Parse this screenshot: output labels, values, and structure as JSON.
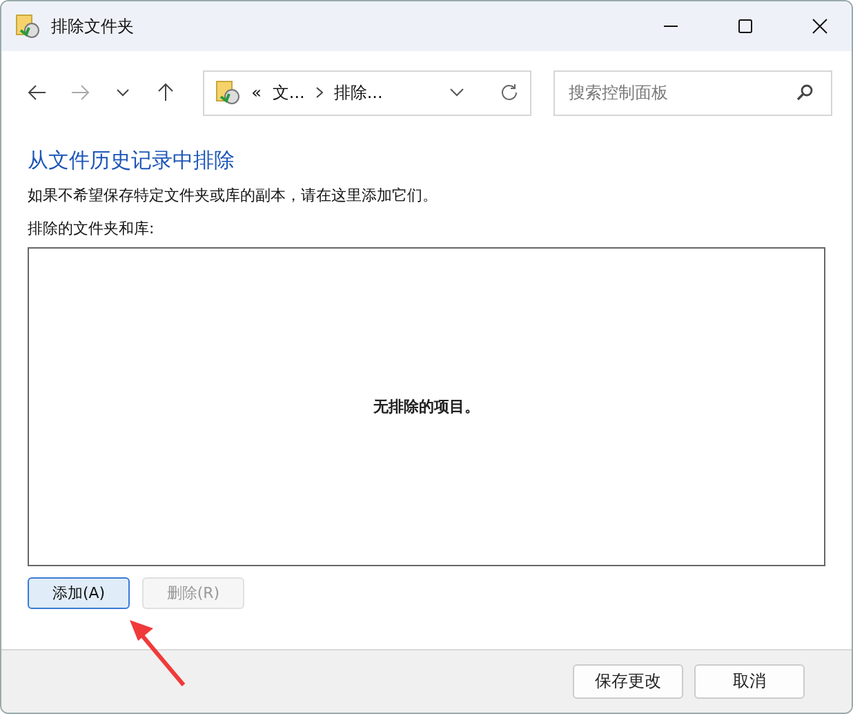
{
  "window": {
    "title": "排除文件夹"
  },
  "address_bar": {
    "overflow": "«",
    "crumbs": [
      "文...",
      "排除..."
    ]
  },
  "search": {
    "placeholder": "搜索控制面板"
  },
  "heading": "从文件历史记录中排除",
  "description": "如果不希望保存特定文件夹或库的副本，请在这里添加它们。",
  "list_label": "排除的文件夹和库:",
  "list": {
    "empty_text": "无排除的项目。"
  },
  "list_buttons": [
    {
      "label": "添加(A)",
      "disabled": false
    },
    {
      "label": "删除(R)",
      "disabled": true
    }
  ],
  "footer_buttons": [
    {
      "label": "保存更改"
    },
    {
      "label": "取消"
    }
  ]
}
